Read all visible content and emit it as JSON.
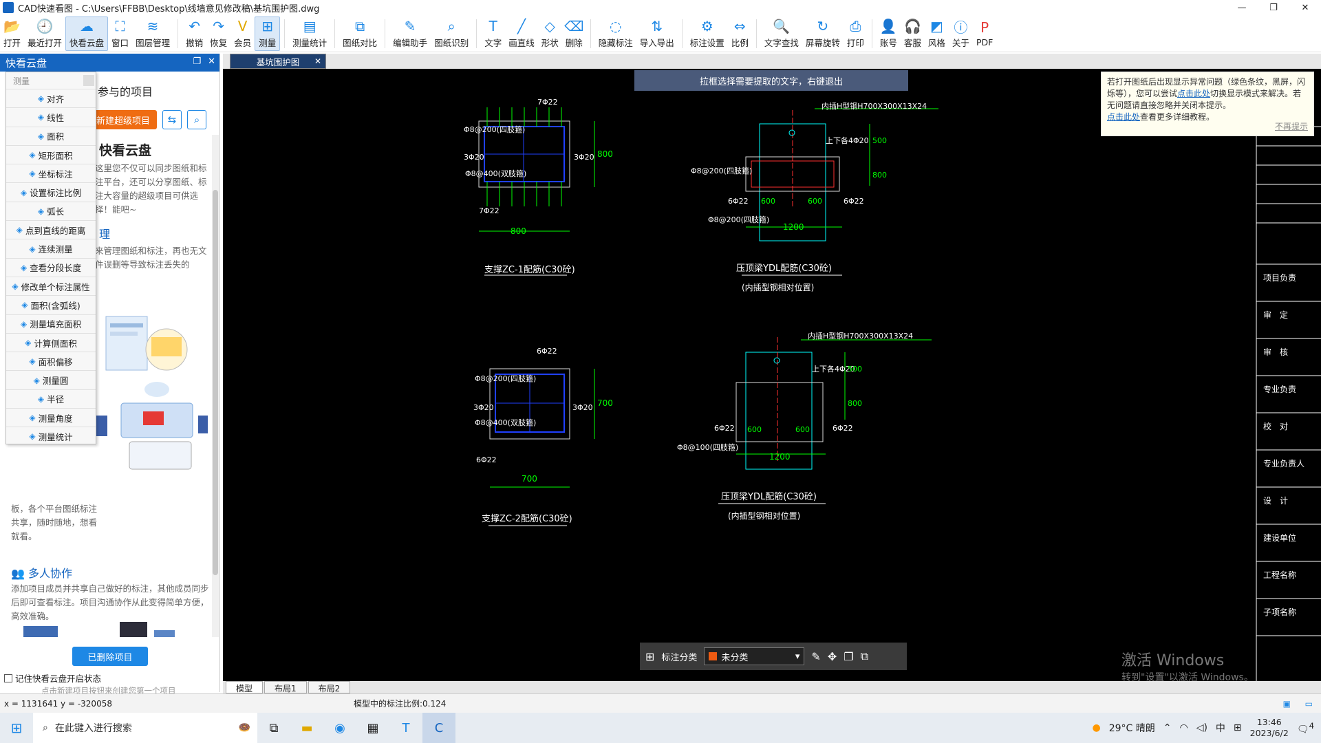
{
  "titlebar": {
    "title": "CAD快速看图 - C:\\Users\\FFBB\\Desktop\\线墙意见修改稿\\基坑围护图.dwg",
    "minimize": "—",
    "maximize": "❐",
    "close": "✕"
  },
  "toolbar": {
    "items": [
      {
        "label": "打开",
        "icon": "📂"
      },
      {
        "label": "最近打开",
        "icon": "🕘"
      },
      {
        "label": "快看云盘",
        "icon": "☁"
      },
      {
        "label": "窗口",
        "icon": "⛶"
      },
      {
        "label": "图层管理",
        "icon": "≋"
      },
      {
        "label": "撤销",
        "icon": "↶"
      },
      {
        "label": "恢复",
        "icon": "↷"
      },
      {
        "label": "会员",
        "icon": "V"
      },
      {
        "label": "测量",
        "icon": "⊞"
      },
      {
        "label": "测量统计",
        "icon": "▤"
      },
      {
        "label": "图纸对比",
        "icon": "⧉"
      },
      {
        "label": "编辑助手",
        "icon": "✎"
      },
      {
        "label": "图纸识别",
        "icon": "⌕"
      },
      {
        "label": "文字",
        "icon": "T"
      },
      {
        "label": "画直线",
        "icon": "╱"
      },
      {
        "label": "形状",
        "icon": "◇"
      },
      {
        "label": "删除",
        "icon": "⌫"
      },
      {
        "label": "隐藏标注",
        "icon": "◌"
      },
      {
        "label": "导入导出",
        "icon": "⇅"
      },
      {
        "label": "标注设置",
        "icon": "⚙"
      },
      {
        "label": "比例",
        "icon": "⇔"
      },
      {
        "label": "文字查找",
        "icon": "🔍"
      },
      {
        "label": "屏幕旋转",
        "icon": "↻"
      },
      {
        "label": "打印",
        "icon": "⎙"
      },
      {
        "label": "账号",
        "icon": "👤"
      },
      {
        "label": "客服",
        "icon": "🎧"
      },
      {
        "label": "风格",
        "icon": "◩"
      },
      {
        "label": "关于",
        "icon": "ⓘ"
      },
      {
        "label": "PDF",
        "icon": "P"
      }
    ]
  },
  "leftpanel": {
    "title": "快看云盘",
    "subtitle": "参与的项目",
    "new_project": "新建超级项目",
    "card_title": "快看云盘",
    "card_text": "这里您不仅可以同步图纸和标注平台，还可以分享图纸、标注大容量的超级项目可供选择！能吧~",
    "manage_title": "理",
    "manage_text": "来管理图纸和标注，再也无文件误删等导致标注丢失的",
    "share_text": "板，各个平台图纸标注共享，随时随地，想看就看。",
    "collab_title": "多人协作",
    "collab_text": "添加项目成员并共享自己做好的标注，其他成员同步后即可查看标注。项目沟通协作从此变得简单方便，高效准确。",
    "deleted_btn": "已删除项目",
    "remember": "记住快看云盘开启状态",
    "hint": "点击新建项目按钮来创建您第一个项目"
  },
  "measure_menu": {
    "header": "测量",
    "items": [
      "对齐",
      "线性",
      "面积",
      "矩形面积",
      "坐标标注",
      "设置标注比例",
      "弧长",
      "点到直线的距离",
      "连续测量",
      "查看分段长度",
      "修改单个标注属性",
      "面积(含弧线)",
      "测量填充面积",
      "计算侧面积",
      "面积偏移",
      "测量圆",
      "半径",
      "测量角度",
      "测量统计"
    ]
  },
  "doc_tab": {
    "label": "基坑围护图",
    "close": "✕"
  },
  "canvas": {
    "hint": "拉框选择需要提取的文字，右键退出",
    "notice": {
      "text1": "若打开图纸后出现显示异常问题（绿色条纹，黑屏，闪烁等），您可以尝试",
      "link1": "点击此处",
      "text2": "切换显示模式来解决。若无问题请直接忽略并关闭本提示。",
      "link2": "点击此处",
      "text3": "查看更多详细教程。",
      "nomore": "不再提示"
    },
    "watermark": {
      "line1": "激活 Windows",
      "line2": "转到\"设置\"以激活 Windows。"
    },
    "anno": {
      "label": "标注分类",
      "value": "未分类"
    },
    "drawings": {
      "zc1": {
        "title": "支撑ZC-1配筋(C30砼)",
        "top": "7Φ22",
        "bottom": "7Φ22",
        "l1": "Φ8@200(四肢箍)",
        "l2": "Φ8@400(双肢箍)",
        "side_l": "3Φ20",
        "side_r": "3Φ20",
        "dim_w": "800",
        "dim_h": "800"
      },
      "ydl1": {
        "title": "压顶梁YDL配筋(C30砼)",
        "sub": "(内插型钢相对位置)",
        "top": "内插H型钢H700X300X13X24",
        "r1": "上下各4Φ20",
        "l1": "Φ8@200(四肢箍)",
        "l2": "Φ8@200(四肢箍)",
        "side_l": "6Φ22",
        "side_r": "6Φ22",
        "d1": "600",
        "d2": "600",
        "dim_w": "1200",
        "dim_h1": "500",
        "dim_h2": "800"
      },
      "zc2": {
        "title": "支撑ZC-2配筋(C30砼)",
        "top": "6Φ22",
        "bottom": "6Φ22",
        "l1": "Φ8@200(四肢箍)",
        "l2": "Φ8@400(双肢箍)",
        "side_l": "3Φ20",
        "side_r": "3Φ20",
        "dim_w": "700",
        "dim_h": "700"
      },
      "ydl2": {
        "title": "压顶梁YDL配筋(C30砼)",
        "sub": "(内插型钢相对位置)",
        "top": "内插H型钢H700X300X13X24",
        "r1": "上下各4Φ20",
        "l1": "Φ8@100(四肢箍)",
        "side_l": "6Φ22",
        "side_r": "6Φ22",
        "d1": "600",
        "d2": "600",
        "dim_w": "1200",
        "dim_h1": "500",
        "dim_h2": "800"
      }
    },
    "titleblock": [
      "项目负责",
      "审　定",
      "审　核",
      "专业负责",
      "校　对",
      "专业负责人",
      "设　计",
      "建设单位",
      "工程名称",
      "子项名称"
    ]
  },
  "bottomtabs": [
    "模型",
    "布局1",
    "布局2"
  ],
  "status": {
    "coords": "x = 1131641  y = -320058",
    "scale": "模型中的标注比例:0.124"
  },
  "taskbar": {
    "search": "在此键入进行搜索",
    "weather": "29°C 晴朗",
    "ime": "中",
    "time": "13:46",
    "date": "2023/6/2",
    "notif": "4"
  },
  "colors": {
    "accent": "#1565c0",
    "orange": "#ef6c12",
    "cad_green": "#00ff00",
    "cad_cyan": "#00ffff",
    "cad_blue": "#2040ff",
    "cad_red": "#ff3030"
  }
}
